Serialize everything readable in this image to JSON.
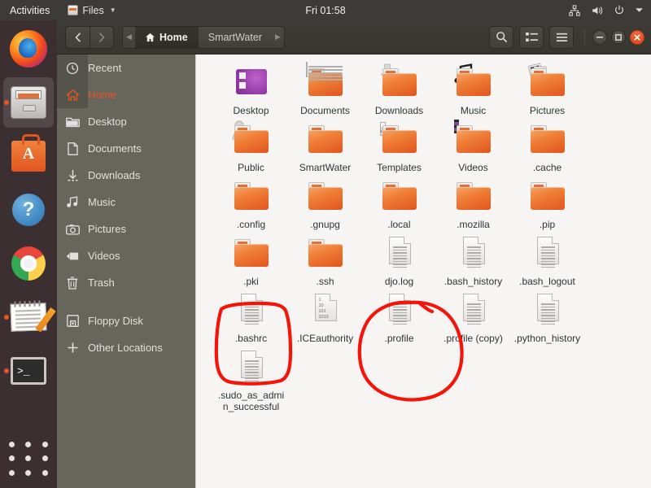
{
  "topbar": {
    "activities": "Activities",
    "app_menu": "Files",
    "clock": "Fri 01:58",
    "icons": [
      "network-icon",
      "volume-icon",
      "power-icon",
      "chevron-down-icon"
    ]
  },
  "dock": {
    "items": [
      {
        "name": "firefox",
        "label": "Firefox",
        "running": false,
        "active": false
      },
      {
        "name": "files",
        "label": "Files",
        "running": true,
        "active": true
      },
      {
        "name": "ubuntu-software",
        "label": "Ubuntu Software",
        "running": false,
        "active": false
      },
      {
        "name": "help",
        "label": "Help",
        "running": false,
        "active": false
      },
      {
        "name": "chrome",
        "label": "Google Chrome",
        "running": false,
        "active": false
      },
      {
        "name": "text-editor",
        "label": "Text Editor",
        "running": true,
        "active": false
      },
      {
        "name": "terminal",
        "label": "Terminal",
        "running": true,
        "active": false
      }
    ],
    "show_apps": "Show Applications"
  },
  "window": {
    "back_label": "‹",
    "forward_label": "›",
    "breadcrumb": [
      {
        "label": "Home",
        "current": true
      },
      {
        "label": "SmartWater",
        "current": false
      }
    ],
    "buttons": {
      "search": "search-icon",
      "view_toggle": "list-view-icon",
      "menu": "hamburger-menu-icon",
      "minimize": "−",
      "maximize": "□",
      "close": "✕"
    }
  },
  "sidebar": {
    "items": [
      {
        "label": "Recent",
        "icon": "clock-icon",
        "active": false,
        "highlight": true
      },
      {
        "label": "Home",
        "icon": "home-icon",
        "active": true,
        "highlight": false
      },
      {
        "label": "Desktop",
        "icon": "folder-icon",
        "active": false,
        "highlight": false
      },
      {
        "label": "Documents",
        "icon": "document-icon",
        "active": false,
        "highlight": false
      },
      {
        "label": "Downloads",
        "icon": "download-icon",
        "active": false,
        "highlight": false
      },
      {
        "label": "Music",
        "icon": "music-icon",
        "active": false,
        "highlight": false
      },
      {
        "label": "Pictures",
        "icon": "camera-icon",
        "active": false,
        "highlight": false
      },
      {
        "label": "Videos",
        "icon": "video-icon",
        "active": false,
        "highlight": false
      },
      {
        "label": "Trash",
        "icon": "trash-icon",
        "active": false,
        "highlight": false
      },
      {
        "label": "Floppy Disk",
        "icon": "floppy-icon",
        "active": false,
        "highlight": false
      },
      {
        "label": "Other Locations",
        "icon": "plus-icon",
        "active": false,
        "highlight": false
      }
    ]
  },
  "files": [
    {
      "name": "Desktop",
      "type": "desktop-folder"
    },
    {
      "name": "Documents",
      "type": "folder-documents"
    },
    {
      "name": "Downloads",
      "type": "folder-downloads"
    },
    {
      "name": "Music",
      "type": "folder-music"
    },
    {
      "name": "Pictures",
      "type": "folder-pictures"
    },
    {
      "name": "Public",
      "type": "folder-public"
    },
    {
      "name": "SmartWater",
      "type": "folder"
    },
    {
      "name": "Templates",
      "type": "folder-templates"
    },
    {
      "name": "Videos",
      "type": "folder-videos"
    },
    {
      "name": ".cache",
      "type": "folder"
    },
    {
      "name": ".config",
      "type": "folder"
    },
    {
      "name": ".gnupg",
      "type": "folder"
    },
    {
      "name": ".local",
      "type": "folder"
    },
    {
      "name": ".mozilla",
      "type": "folder"
    },
    {
      "name": ".pip",
      "type": "folder"
    },
    {
      "name": ".pki",
      "type": "folder"
    },
    {
      "name": ".ssh",
      "type": "folder"
    },
    {
      "name": "djo.log",
      "type": "text-file"
    },
    {
      "name": ".bash_history",
      "type": "text-file"
    },
    {
      "name": ".bash_logout",
      "type": "text-file"
    },
    {
      "name": ".bashrc",
      "type": "text-file"
    },
    {
      "name": ".ICEauthority",
      "type": "binary-file"
    },
    {
      "name": ".profile",
      "type": "text-file"
    },
    {
      "name": ".profile (copy)",
      "type": "text-file"
    },
    {
      "name": ".python_history",
      "type": "text-file"
    },
    {
      "name": ".sudo_as_admin_successful",
      "type": "text-file"
    }
  ],
  "annotations": {
    "color": "#f41408",
    "shapes": [
      {
        "name": "bashrc-highlight",
        "target": ".bashrc",
        "shape": "blob-rectangle"
      },
      {
        "name": "profile-highlight",
        "target": ".profile",
        "shape": "circle"
      }
    ]
  }
}
